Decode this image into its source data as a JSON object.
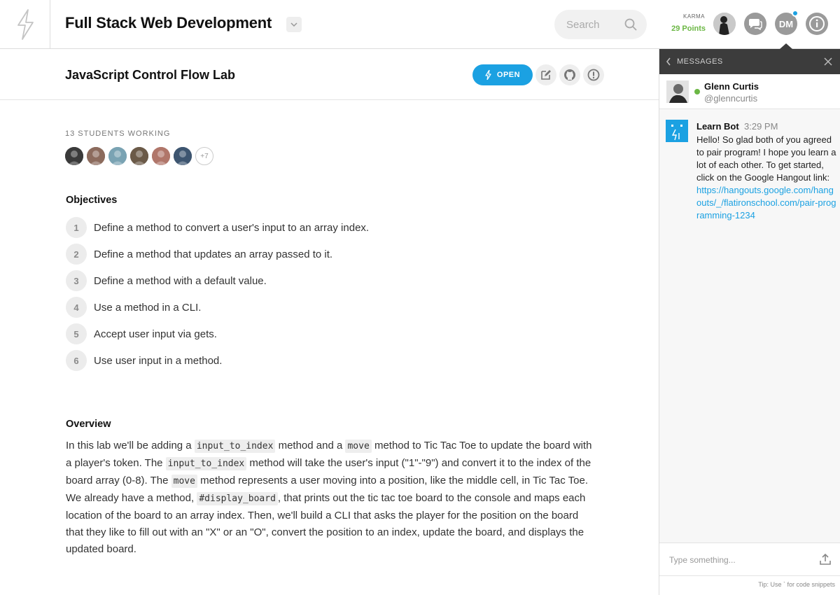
{
  "header": {
    "course_title": "Full Stack Web Development",
    "search_placeholder": "Search",
    "karma_label": "KARMA",
    "karma_points": "29 Points",
    "user_initials": "DM"
  },
  "lab": {
    "title": "JavaScript Control Flow Lab",
    "open_label": "OPEN"
  },
  "students": {
    "label": "13 STUDENTS WORKING",
    "more": "+7",
    "avatar_colors": [
      "#3a3a3a",
      "#8c6b5d",
      "#7aa3b3",
      "#6b5a48",
      "#b0766a",
      "#3d5570"
    ]
  },
  "objectives": {
    "heading": "Objectives",
    "items": [
      {
        "num": "1",
        "text": "Define a method to convert a user's input to an array index."
      },
      {
        "num": "2",
        "text": "Define a method that updates an array passed to it."
      },
      {
        "num": "3",
        "text": "Define a method with a default value."
      },
      {
        "num": "4",
        "text": "Use a method in a CLI."
      },
      {
        "num": "5",
        "text": "Accept user input via gets."
      },
      {
        "num": "6",
        "text": "Use user input in a method."
      }
    ]
  },
  "overview": {
    "heading": "Overview",
    "t1": "In this lab we'll be adding a ",
    "c1": "input_to_index",
    "t2": " method and a ",
    "c2": "move",
    "t3": " method to Tic Tac Toe to update the board with a player's token. The ",
    "c3": "input_to_index",
    "t4": " method will take the user's input (\"1\"-\"9\") and convert it to the index of the board array (0-8). The ",
    "c4": "move",
    "t5": " method represents a user moving into a position, like the middle cell, in Tic Tac Toe. We already have a method, ",
    "c5": "#display_board",
    "t6": ", that prints out the tic tac toe board to the console and maps each location of the board to an array index. Then, we'll build a CLI that asks the player for the position on the board that they like to fill out with an \"X\" or an \"O\", convert the position to an index, update the board, and displays the updated board."
  },
  "messages_panel": {
    "title": "MESSAGES",
    "peer_name": "Glenn Curtis",
    "peer_handle": "@glenncurtis",
    "bot_name": "Learn Bot",
    "bot_time": "3:29 PM",
    "bot_text": "Hello! So glad both of you agreed to pair program! I hope you learn a lot of each other. To get started, click on the Google Hangout link:",
    "bot_link": "https://hangouts.google.com/hangouts/_/flatironschool.com/pair-programming-1234",
    "compose_placeholder": "Type something...",
    "tip": "Tip: Use ` for code snippets"
  },
  "colors": {
    "accent": "#1ba1e2",
    "karma_green": "#6bb744",
    "panel_header": "#3c3c3c"
  }
}
